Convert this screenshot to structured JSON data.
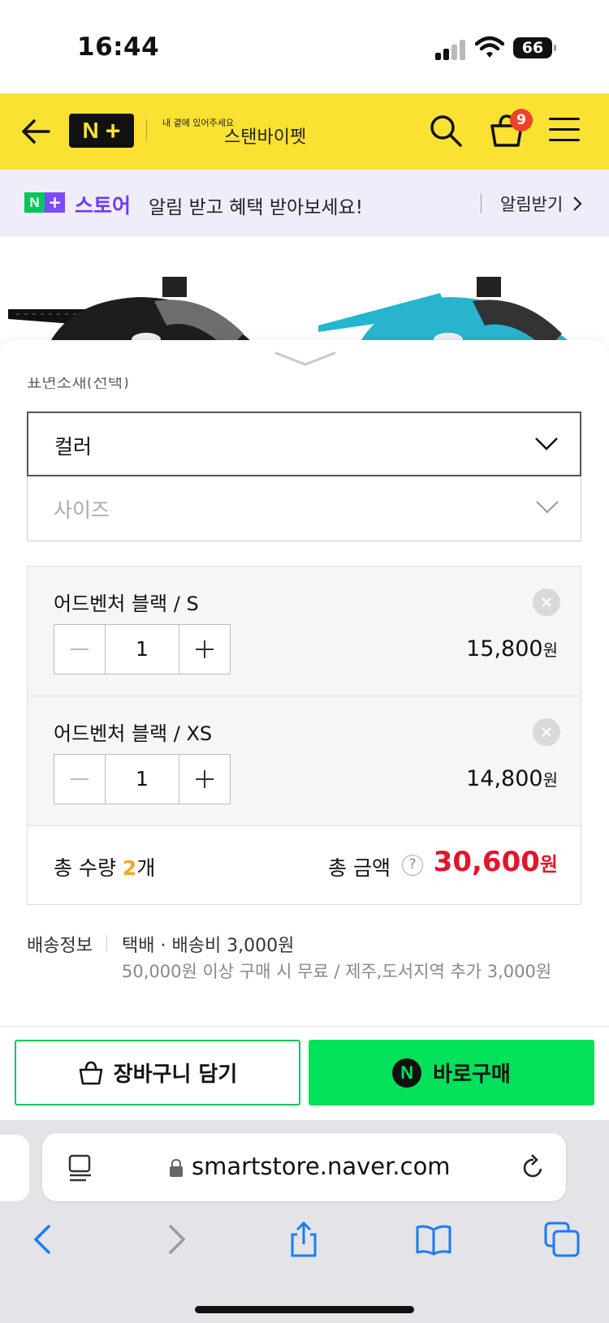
{
  "status_bar": {
    "time": "16:44",
    "battery": "66"
  },
  "header": {
    "logo": "N+",
    "slogan": "내 곁에 있어주세요",
    "store_name": "스탠바이펫",
    "cart_count": "9"
  },
  "promo": {
    "logo_letters": [
      "N",
      "+"
    ],
    "store_label": "스토어",
    "text": "알림 받고 혜택 받아보세요!",
    "cta": "알림받기"
  },
  "options": {
    "cut_label": "표면소재(선택)",
    "color_select": "컬러",
    "size_select": "사이즈"
  },
  "selected_items": [
    {
      "name": "어드벤처 블랙 / S",
      "qty": "1",
      "price": "15,800",
      "unit": "원"
    },
    {
      "name": "어드벤처 블랙 / XS",
      "qty": "1",
      "price": "14,800",
      "unit": "원"
    }
  ],
  "totals": {
    "qty_prefix": "총 수량",
    "qty_value": "2",
    "qty_suffix": "개",
    "amount_label": "총 금액",
    "help": "?",
    "amount_value": "30,600",
    "amount_unit": "원"
  },
  "shipping": {
    "title": "배송정보",
    "method": "택배 · 배송비 3,000원",
    "note": "50,000원 이상 구매 시 무료 / 제주,도서지역 추가 3,000원"
  },
  "buy_bar": {
    "cart_label": "장바구니 담기",
    "buy_badge": "N",
    "buy_label": "바로구매"
  },
  "browser": {
    "url": "smartstore.naver.com"
  },
  "colors": {
    "header": "#fbe232",
    "naver_green": "#03c75a",
    "price_red": "#e0162b",
    "promo_purple": "#6b3ef0"
  }
}
